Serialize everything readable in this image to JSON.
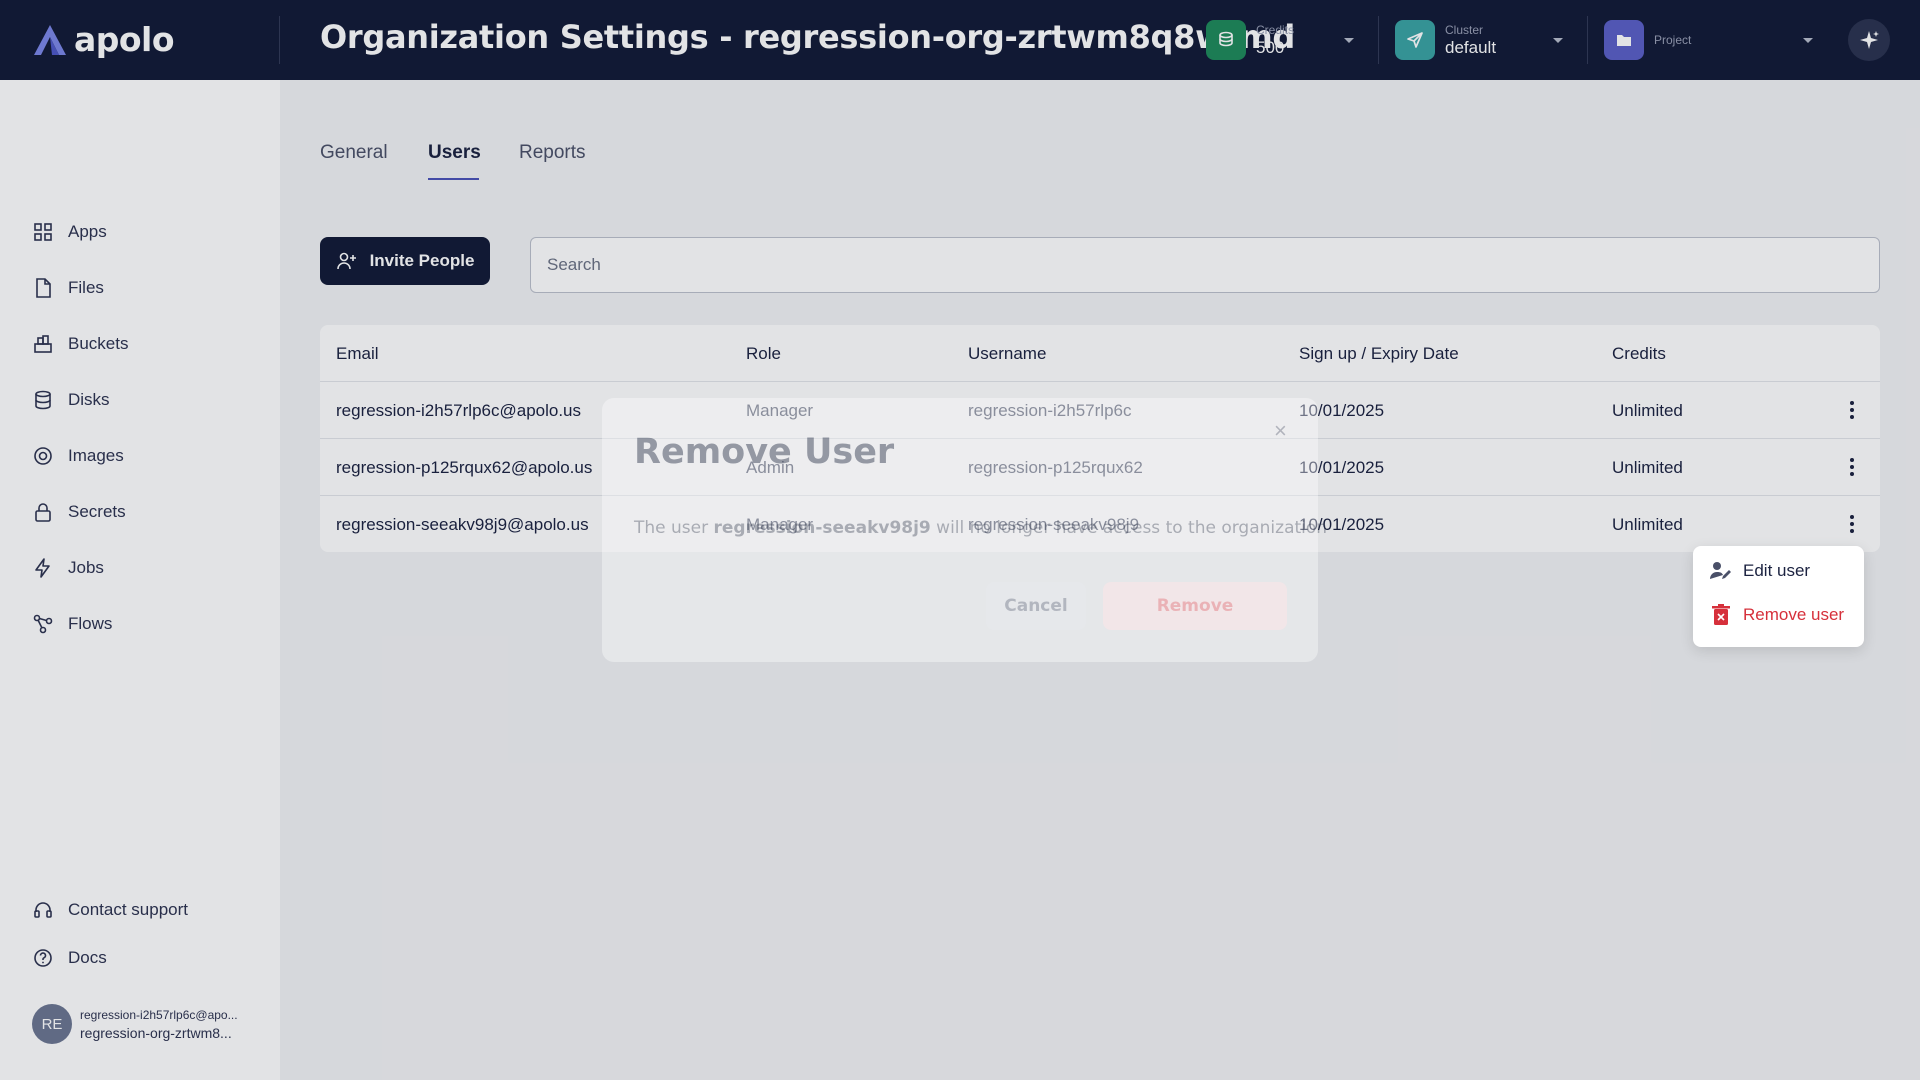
{
  "app": {
    "logo_text": "apolo",
    "page_title": "Organization Settings - regression-org-zrtwm8q8wtmd",
    "colors": {
      "topbar": "#121a36",
      "accent": "#4b53b8",
      "credits_icon": "#1e8a5a",
      "cluster_icon": "#3aa3a3",
      "project_icon": "#5b5fc7",
      "danger": "#d6303b"
    }
  },
  "header": {
    "credits": {
      "label": "Credits",
      "value": "500",
      "icon": "coins-icon"
    },
    "cluster": {
      "label": "Cluster",
      "value": "default",
      "icon": "send-icon"
    },
    "project": {
      "label": "Project",
      "value": "",
      "icon": "folder-icon"
    },
    "assistant_icon": "sparkle-icon"
  },
  "sidebar": {
    "items": [
      {
        "label": "Apps",
        "icon": "grid-icon"
      },
      {
        "label": "Files",
        "icon": "file-icon"
      },
      {
        "label": "Buckets",
        "icon": "bucket-icon"
      },
      {
        "label": "Disks",
        "icon": "database-icon"
      },
      {
        "label": "Images",
        "icon": "image-icon"
      },
      {
        "label": "Secrets",
        "icon": "lock-icon"
      },
      {
        "label": "Jobs",
        "icon": "bolt-icon"
      },
      {
        "label": "Flows",
        "icon": "flow-icon"
      }
    ],
    "footer": [
      {
        "label": "Contact support",
        "icon": "headset-icon"
      },
      {
        "label": "Docs",
        "icon": "help-icon"
      }
    ],
    "user": {
      "initials": "RE",
      "email": "regression-i2h57rlp6c@apo...",
      "org": "regression-org-zrtwm8..."
    }
  },
  "tabs": [
    {
      "label": "General",
      "active": false
    },
    {
      "label": "Users",
      "active": true
    },
    {
      "label": "Reports",
      "active": false
    }
  ],
  "toolbar": {
    "invite_label": "Invite People",
    "search_placeholder": "Search"
  },
  "table": {
    "columns": [
      "Email",
      "Role",
      "Username",
      "Sign up / Expiry Date",
      "Credits"
    ],
    "rows": [
      {
        "email": "regression-i2h57rlp6c@apolo.us",
        "role": "Manager",
        "username": "regression-i2h57rlp6c",
        "date": "10/01/2025",
        "credits": "Unlimited"
      },
      {
        "email": "regression-p125rqux62@apolo.us",
        "role": "Admin",
        "username": "regression-p125rqux62",
        "date": "10/01/2025",
        "credits": "Unlimited"
      },
      {
        "email": "regression-seeakv98j9@apolo.us",
        "role": "Manager",
        "username": "regression-seeakv98j9",
        "date": "10/01/2025",
        "credits": "Unlimited"
      }
    ]
  },
  "modal": {
    "title": "Remove User",
    "text_before": "The user ",
    "text_user": "regression-seeakv98j9",
    "text_after": " will no longer have access to the organization",
    "close": "×",
    "cancel_label": "Cancel",
    "remove_label": "Remove"
  },
  "context_menu": {
    "edit_label": "Edit user",
    "remove_label": "Remove user"
  }
}
